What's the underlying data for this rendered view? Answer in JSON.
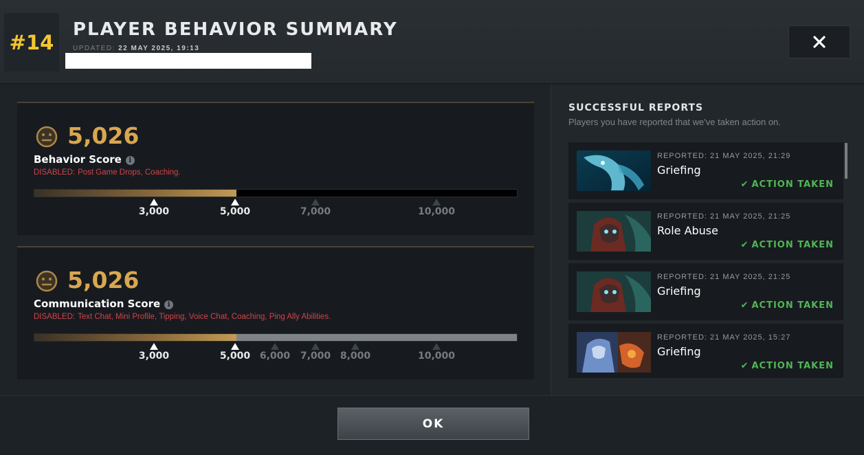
{
  "header": {
    "rank": "#14",
    "title": "PLAYER BEHAVIOR SUMMARY",
    "updated_label": "UPDATED:",
    "updated_value": "22 MAY 2025, 19:13"
  },
  "behavior": {
    "value": "5,026",
    "label": "Behavior Score",
    "disabled_label": "DISABLED:",
    "disabled_items": "Post Game Drops, Coaching.",
    "score": 5026,
    "ticks": [
      "3,000",
      "5,000",
      "7,000",
      "10,000"
    ]
  },
  "communication": {
    "value": "5,026",
    "label": "Communication Score",
    "disabled_label": "DISABLED:",
    "disabled_items": "Text Chat, Mini Profile, Tipping, Voice Chat, Coaching, Ping Ally Abilities.",
    "score": 5026,
    "ticks": [
      "3,000",
      "5,000",
      "6,000",
      "7,000",
      "8,000",
      "10,000"
    ]
  },
  "reports": {
    "title": "SUCCESSFUL REPORTS",
    "subtitle": "Players you have reported that we've taken action on.",
    "items": [
      {
        "meta": "REPORTED: 21 MAY 2025, 21:29",
        "reason": "Griefing",
        "action": "ACTION TAKEN",
        "hero_icon": "morphling-portrait"
      },
      {
        "meta": "REPORTED: 21 MAY 2025, 21:25",
        "reason": "Role Abuse",
        "action": "ACTION TAKEN",
        "hero_icon": "terrorblade-portrait"
      },
      {
        "meta": "REPORTED: 21 MAY 2025, 21:25",
        "reason": "Griefing",
        "action": "ACTION TAKEN",
        "hero_icon": "terrorblade-portrait"
      },
      {
        "meta": "REPORTED: 21 MAY 2025, 15:27",
        "reason": "Griefing",
        "action": "ACTION TAKEN",
        "hero_icon": "ancient-apparition-portrait"
      }
    ]
  },
  "footer": {
    "ok_label": "OK"
  },
  "colors": {
    "accent_gold": "#d9a74f",
    "rank_yellow": "#f5c531",
    "disabled_red": "#d0434a",
    "action_green": "#51b554"
  }
}
